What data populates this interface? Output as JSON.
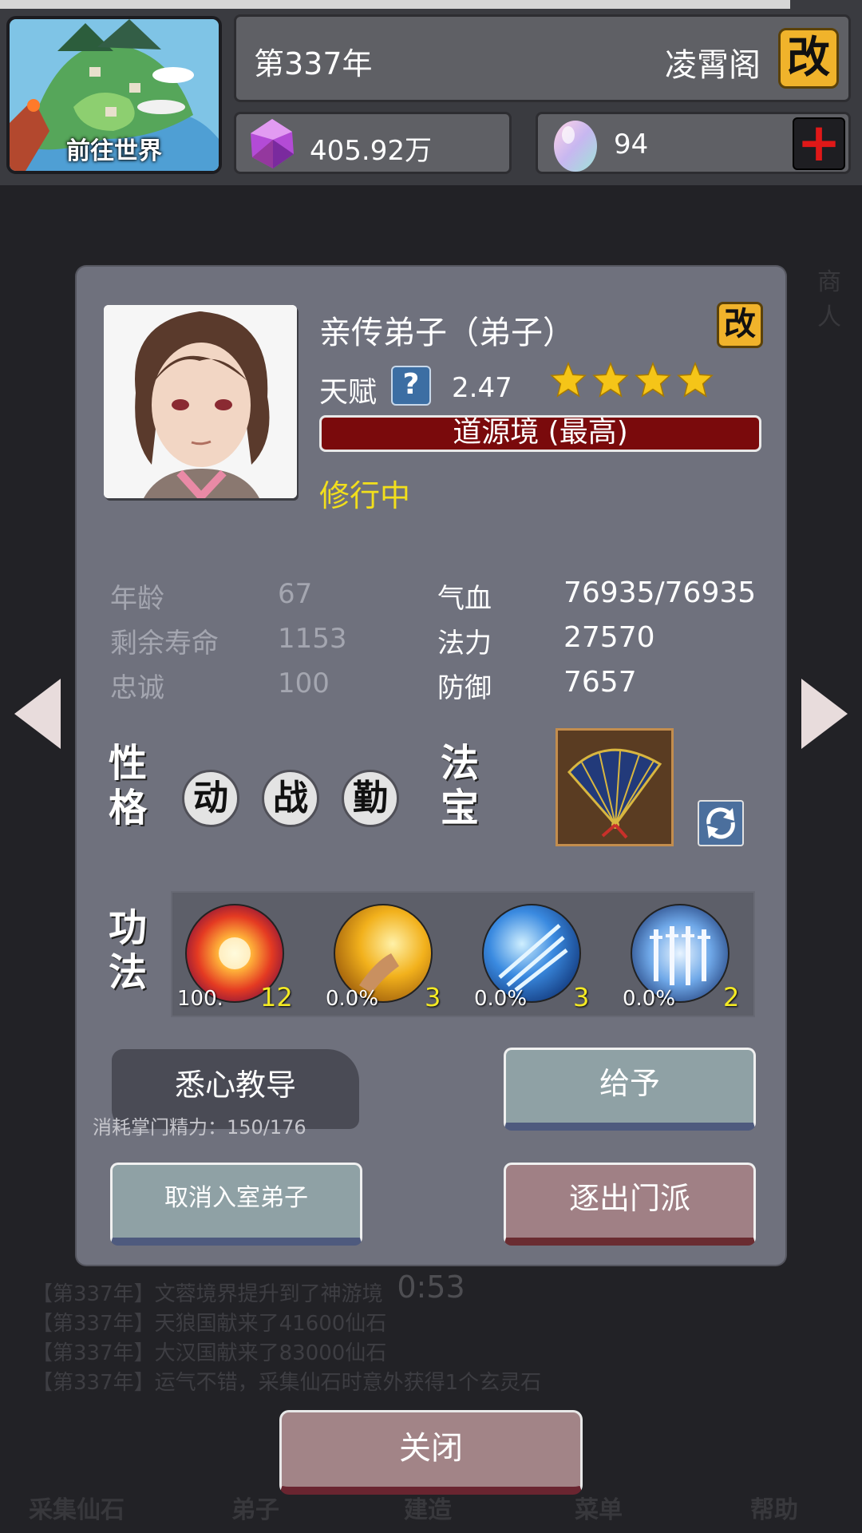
{
  "header": {
    "world_button_label": "前往世界",
    "year": "第337年",
    "sect_name": "凌霄阁",
    "rename_glyph": "改",
    "spirit_stones": "405.92万",
    "spirit_eggs": "94",
    "add_glyph": "+"
  },
  "disciple": {
    "name": "亲传弟子（弟子）",
    "rename_glyph": "改",
    "talent_label": "天赋",
    "talent_help": "?",
    "talent_value": "2.47",
    "stars": 4,
    "realm": "道源境 (最高)",
    "status": "修行中",
    "stats_left": [
      {
        "label": "年龄",
        "value": "67"
      },
      {
        "label": "剩余寿命",
        "value": "1153"
      },
      {
        "label": "忠诚",
        "value": "100"
      }
    ],
    "stats_right": [
      {
        "label": "气血",
        "value": "76935/76935"
      },
      {
        "label": "法力",
        "value": "27570"
      },
      {
        "label": "防御",
        "value": "7657"
      }
    ],
    "personality_title": [
      "性",
      "格"
    ],
    "traits": [
      "动",
      "战",
      "勤"
    ],
    "treasure_title": [
      "法",
      "宝"
    ],
    "skills_title": [
      "功",
      "法"
    ],
    "skills": [
      {
        "icon": "fire-explosion-icon",
        "progress": "100.",
        "level": "12"
      },
      {
        "icon": "golden-fist-icon",
        "progress": "0.0%",
        "level": "3"
      },
      {
        "icon": "ice-sword-icon",
        "progress": "0.0%",
        "level": "3"
      },
      {
        "icon": "lightning-swords-icon",
        "progress": "0.0%",
        "level": "2"
      }
    ]
  },
  "actions": {
    "teach_label": "悉心教导",
    "teach_cost": "消耗掌门精力：150/176",
    "give_label": "给予",
    "cancel_label": "取消入室弟子",
    "expel_label": "逐出门派",
    "close_label": "关闭"
  },
  "background": {
    "timer": "0:53",
    "log": [
      "【第337年】文蓉境界提升到了神游境",
      "【第337年】天狼国献来了41600仙石",
      "【第337年】大汉国献来了83000仙石",
      "【第337年】运气不错，采集仙石时意外获得1个玄灵石"
    ],
    "bottom_nav": [
      "采集仙石",
      "弟子",
      "建造",
      "菜单",
      "帮助"
    ],
    "npc_label": "商人"
  },
  "colors": {
    "dialog_bg": "#6f717d",
    "realm_bar": "#7a0a0c",
    "status_text": "#f2df1c",
    "skill_level": "#f4ea24",
    "star": "#f5c518",
    "rename_button": "#f0b32b"
  }
}
